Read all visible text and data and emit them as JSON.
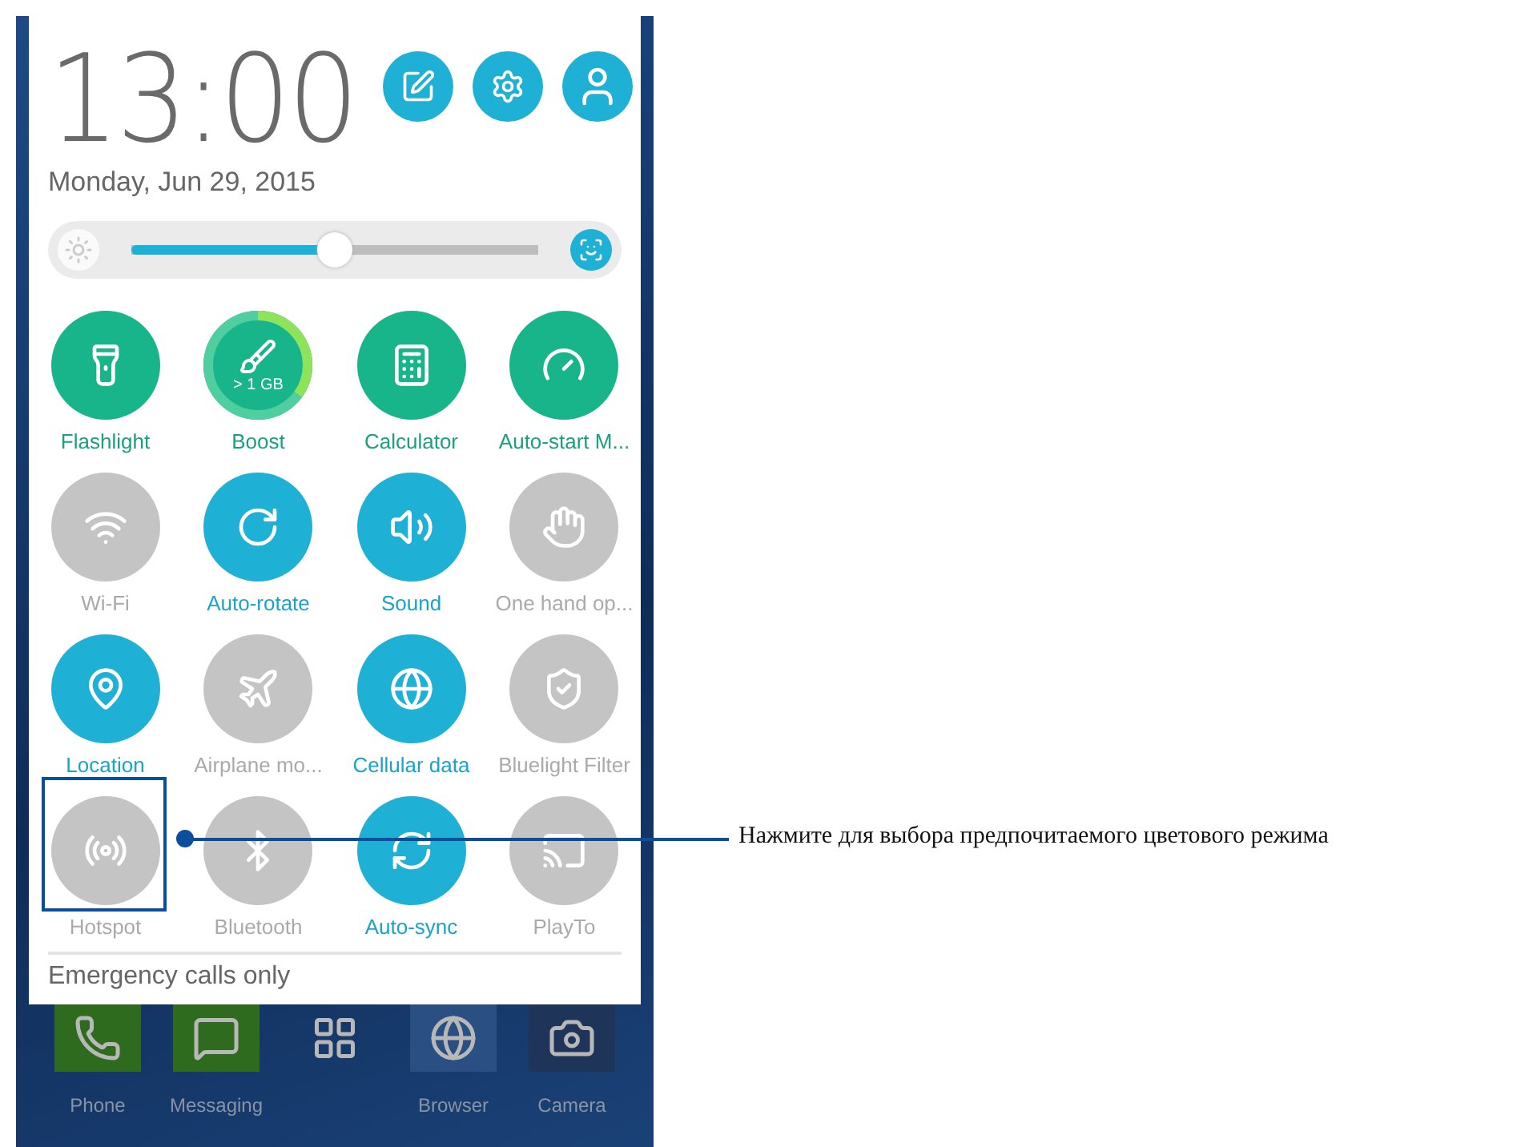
{
  "header": {
    "time": "13:00",
    "date": "Monday, Jun 29, 2015"
  },
  "brightness": {
    "level": 0.5
  },
  "tiles": [
    {
      "label": "Flashlight",
      "kind": "shortcut"
    },
    {
      "label": "Boost",
      "kind": "meter"
    },
    {
      "label": "Calculator",
      "kind": "shortcut"
    },
    {
      "label": "Auto-start M...",
      "kind": "shortcut"
    },
    {
      "label": "Wi-Fi",
      "kind": "toggle",
      "on": false
    },
    {
      "label": "Auto-rotate",
      "kind": "toggle",
      "on": true
    },
    {
      "label": "Sound",
      "kind": "toggle",
      "on": true
    },
    {
      "label": "One hand op...",
      "kind": "toggle",
      "on": false
    },
    {
      "label": "Location",
      "kind": "toggle",
      "on": true
    },
    {
      "label": "Airplane mo...",
      "kind": "toggle",
      "on": false
    },
    {
      "label": "Cellular data",
      "kind": "toggle",
      "on": true
    },
    {
      "label": "Bluelight Filter",
      "kind": "toggle",
      "on": false
    },
    {
      "label": "Hotspot",
      "kind": "toggle",
      "on": false
    },
    {
      "label": "Bluetooth",
      "kind": "toggle",
      "on": false
    },
    {
      "label": "Auto-sync",
      "kind": "toggle",
      "on": true
    },
    {
      "label": "PlayTo",
      "kind": "toggle",
      "on": false
    }
  ],
  "memory_usage": {
    "text": "> 1 GB"
  },
  "status": "Emergency calls only",
  "dock": [
    {
      "kind": "app",
      "label": "Phone"
    },
    {
      "kind": "app",
      "label": "Messaging"
    },
    {
      "kind": "drawer"
    },
    {
      "kind": "app",
      "label": "Browser"
    },
    {
      "kind": "app",
      "label": "Camera"
    }
  ],
  "callout": {
    "text": "Нажмите для выбора предпочитаемого цветового режима"
  }
}
